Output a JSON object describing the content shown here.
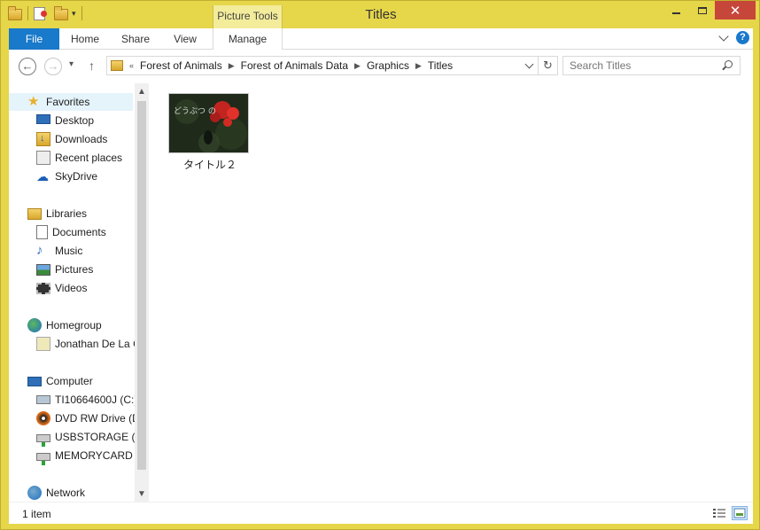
{
  "window": {
    "title": "Titles",
    "context_tab_group": "Picture Tools"
  },
  "ribbon": {
    "tabs": [
      "File",
      "Home",
      "Share",
      "View",
      "Manage"
    ],
    "help_label": "?"
  },
  "navigation": {
    "back_glyph": "←",
    "forward_glyph": "→",
    "recent_glyph": "▾",
    "up_glyph": "↑",
    "breadcrumb_overflow": "«",
    "breadcrumbs": [
      "Forest of Animals",
      "Forest of Animals Data",
      "Graphics",
      "Titles"
    ],
    "refresh_glyph": "↻"
  },
  "search": {
    "placeholder": "Search Titles"
  },
  "sidebar": {
    "items": [
      {
        "label": "Favorites",
        "icon": "star-icon",
        "level": 0,
        "selected": true
      },
      {
        "label": "Desktop",
        "icon": "desktop-icon",
        "level": 1
      },
      {
        "label": "Downloads",
        "icon": "downloads-icon",
        "level": 1
      },
      {
        "label": "Recent places",
        "icon": "recent-places-icon",
        "level": 1
      },
      {
        "label": "SkyDrive",
        "icon": "skydrive-icon",
        "level": 1
      },
      {
        "label": "Libraries",
        "icon": "libraries-icon",
        "level": 0
      },
      {
        "label": "Documents",
        "icon": "documents-icon",
        "level": 1
      },
      {
        "label": "Music",
        "icon": "music-icon",
        "level": 1
      },
      {
        "label": "Pictures",
        "icon": "pictures-icon",
        "level": 1
      },
      {
        "label": "Videos",
        "icon": "videos-icon",
        "level": 1
      },
      {
        "label": "Homegroup",
        "icon": "homegroup-icon",
        "level": 0
      },
      {
        "label": "Jonathan De La C",
        "icon": "user-icon",
        "level": 1
      },
      {
        "label": "Computer",
        "icon": "computer-icon",
        "level": 0
      },
      {
        "label": "TI10664600J (C:)",
        "icon": "local-disk-icon",
        "level": 1
      },
      {
        "label": "DVD RW Drive (D",
        "icon": "dvd-drive-icon",
        "level": 1
      },
      {
        "label": "USBSTORAGE (\\\\",
        "icon": "network-drive-icon",
        "level": 1
      },
      {
        "label": "MEMORYCARD (",
        "icon": "network-drive-icon",
        "level": 1
      },
      {
        "label": "Network",
        "icon": "network-icon",
        "level": 0
      }
    ],
    "scroll_up_glyph": "▲",
    "scroll_down_glyph": "▼"
  },
  "files": [
    {
      "name": "タイトル２",
      "thumbnail_text": "どうぶつ の"
    }
  ],
  "status": {
    "item_count": "1 item"
  },
  "colors": {
    "frame": "#e6d64a",
    "file_tab": "#1979ca",
    "close_button": "#c7463a",
    "selection": "#e5f3fb"
  }
}
